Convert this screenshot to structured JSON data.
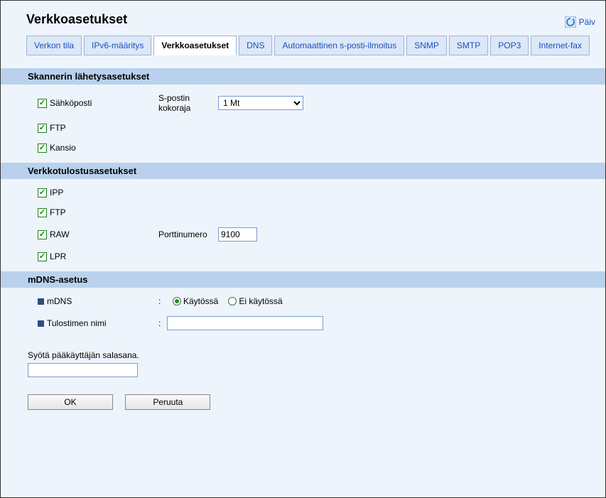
{
  "header": {
    "title": "Verkkoasetukset",
    "refresh": "Päiv"
  },
  "tabs": [
    "Verkon tila",
    "IPv6-määritys",
    "Verkkoasetukset",
    "DNS",
    "Automaattinen s-posti-ilmoitus",
    "SNMP",
    "SMTP",
    "POP3",
    "Internet-fax"
  ],
  "active_tab_index": 2,
  "scanner": {
    "title": "Skannerin lähetysasetukset",
    "email_label": "Sähköposti",
    "email_checked": true,
    "size_label": "S-postin kokoraja",
    "size_value": "1 Mt",
    "ftp_label": "FTP",
    "ftp_checked": true,
    "folder_label": "Kansio",
    "folder_checked": true
  },
  "netprint": {
    "title": "Verkkotulostusasetukset",
    "ipp_label": "IPP",
    "ipp_checked": true,
    "ftp_label": "FTP",
    "ftp_checked": true,
    "raw_label": "RAW",
    "raw_checked": true,
    "port_label": "Porttinumero",
    "port_value": "9100",
    "lpr_label": "LPR",
    "lpr_checked": true
  },
  "mdns": {
    "title": "mDNS-asetus",
    "mdns_label": "mDNS",
    "colon": ":",
    "on_label": "Käytössä",
    "off_label": "Ei käytössä",
    "mdns_on": true,
    "printer_name_label": "Tulostimen nimi",
    "printer_name_value": ""
  },
  "footer": {
    "password_prompt": "Syötä pääkäyttäjän salasana.",
    "password_value": "",
    "ok": "OK",
    "cancel": "Peruuta"
  }
}
